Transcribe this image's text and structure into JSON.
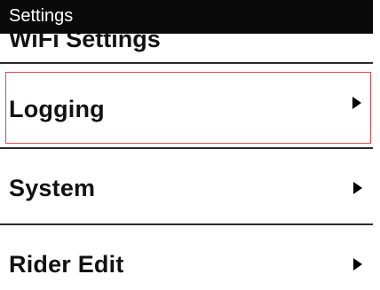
{
  "title_bar": {
    "title": "Settings"
  },
  "partial_item": {
    "label": "WiFi Settings"
  },
  "menu": {
    "items": [
      {
        "label": "Logging",
        "arrow_icon": "chevron-right-icon",
        "selected": true
      },
      {
        "label": "System",
        "arrow_icon": "chevron-right-icon",
        "selected": false
      },
      {
        "label": "Rider Edit",
        "arrow_icon": "chevron-right-icon",
        "selected": false
      }
    ]
  },
  "colors": {
    "title_bar_bg": "#0a0a0a",
    "title_text": "#ffffff",
    "selection_border": "#e04848",
    "divider": "#2a2a2a",
    "background": "#ffffff"
  }
}
